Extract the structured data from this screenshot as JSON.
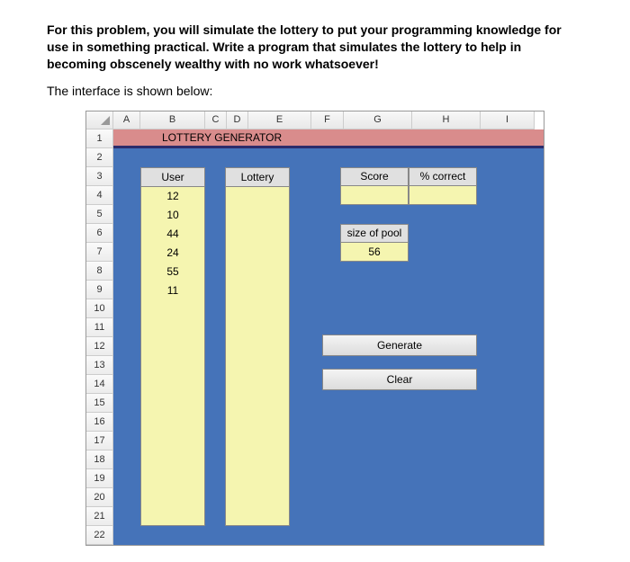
{
  "prompt_text": "For this problem, you will simulate the lottery to put your programming knowledge for use in something practical. Write a program that simulates the lottery to help in becoming obscenely wealthy with no work whatsoever!",
  "subprompt_text": "The interface is shown below:",
  "columns": {
    "A": "A",
    "B": "B",
    "C": "C",
    "D": "D",
    "E": "E",
    "F": "F",
    "G": "G",
    "H": "H",
    "I": "I"
  },
  "rows": [
    "1",
    "2",
    "3",
    "4",
    "5",
    "6",
    "7",
    "8",
    "9",
    "10",
    "11",
    "12",
    "13",
    "14",
    "15",
    "16",
    "17",
    "18",
    "19",
    "20",
    "21",
    "22"
  ],
  "title": "LOTTERY GENERATOR",
  "user": {
    "header": "User",
    "values": [
      "12",
      "10",
      "44",
      "24",
      "55",
      "11"
    ]
  },
  "lottery": {
    "header": "Lottery",
    "values": []
  },
  "score": {
    "label": "Score",
    "value": ""
  },
  "percent": {
    "label": "% correct",
    "value": ""
  },
  "pool": {
    "label": "size of pool",
    "value": "56"
  },
  "buttons": {
    "generate": "Generate",
    "clear": "Clear"
  },
  "chart_data": {
    "type": "table",
    "title": "LOTTERY GENERATOR",
    "columns": [
      "User",
      "Lottery"
    ],
    "user_values": [
      12,
      10,
      44,
      24,
      55,
      11
    ],
    "lottery_values": [],
    "score": null,
    "percent_correct": null,
    "size_of_pool": 56
  }
}
